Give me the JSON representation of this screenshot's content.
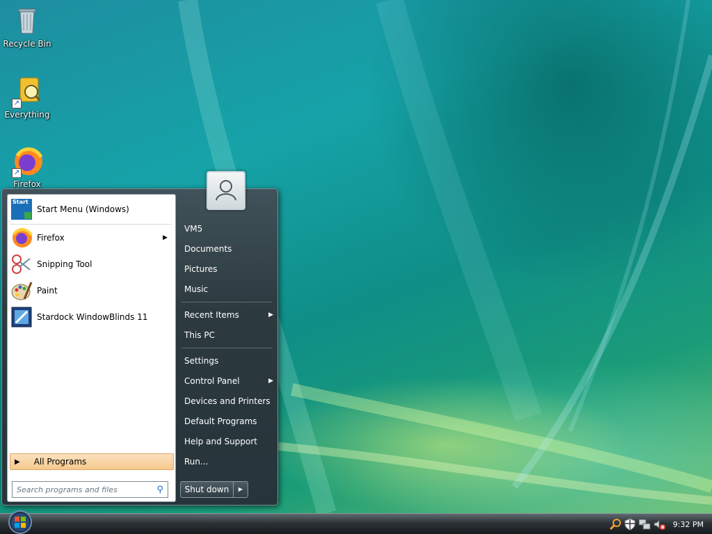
{
  "desktop": {
    "icons": [
      {
        "label": "Recycle Bin",
        "icon": "recycle-bin-icon"
      },
      {
        "label": "Everything",
        "icon": "everything-icon"
      },
      {
        "label": "Firefox",
        "icon": "firefox-icon"
      }
    ]
  },
  "start_menu": {
    "pinned": [
      {
        "label": "Start Menu (Windows)",
        "icon": "start-menu-icon",
        "icon_text": "Start"
      }
    ],
    "programs": [
      {
        "label": "Firefox",
        "icon": "firefox-icon",
        "submenu": true
      },
      {
        "label": "Snipping Tool",
        "icon": "scissors-icon",
        "submenu": false
      },
      {
        "label": "Paint",
        "icon": "paint-palette-icon",
        "submenu": false
      },
      {
        "label": "Stardock WindowBlinds 11",
        "icon": "windowblinds-icon",
        "submenu": false
      }
    ],
    "all_programs_label": "All Programs",
    "search_placeholder": "Search programs and files",
    "right_items": [
      {
        "label": "VM5",
        "submenu": false
      },
      {
        "label": "Documents",
        "submenu": false
      },
      {
        "label": "Pictures",
        "submenu": false
      },
      {
        "label": "Music",
        "submenu": false
      },
      {
        "label": "Recent Items",
        "submenu": true
      },
      {
        "label": "This PC",
        "submenu": false
      },
      {
        "label": "Settings",
        "submenu": false
      },
      {
        "label": "Control Panel",
        "submenu": true
      },
      {
        "label": "Devices and Printers",
        "submenu": false
      },
      {
        "label": "Default Programs",
        "submenu": false
      },
      {
        "label": "Help and Support",
        "submenu": false
      },
      {
        "label": "Run...",
        "submenu": false
      }
    ],
    "shutdown_label": "Shut down"
  },
  "taskbar": {
    "clock": "9:32 PM",
    "tray_icons": [
      "search-icon",
      "security-shield-icon",
      "network-icon",
      "volume-muted-icon"
    ]
  },
  "colors": {
    "accent_highlight": "#f6c98c",
    "menu_dark": "#2c393f",
    "tray_alert": "#e63a2a"
  }
}
